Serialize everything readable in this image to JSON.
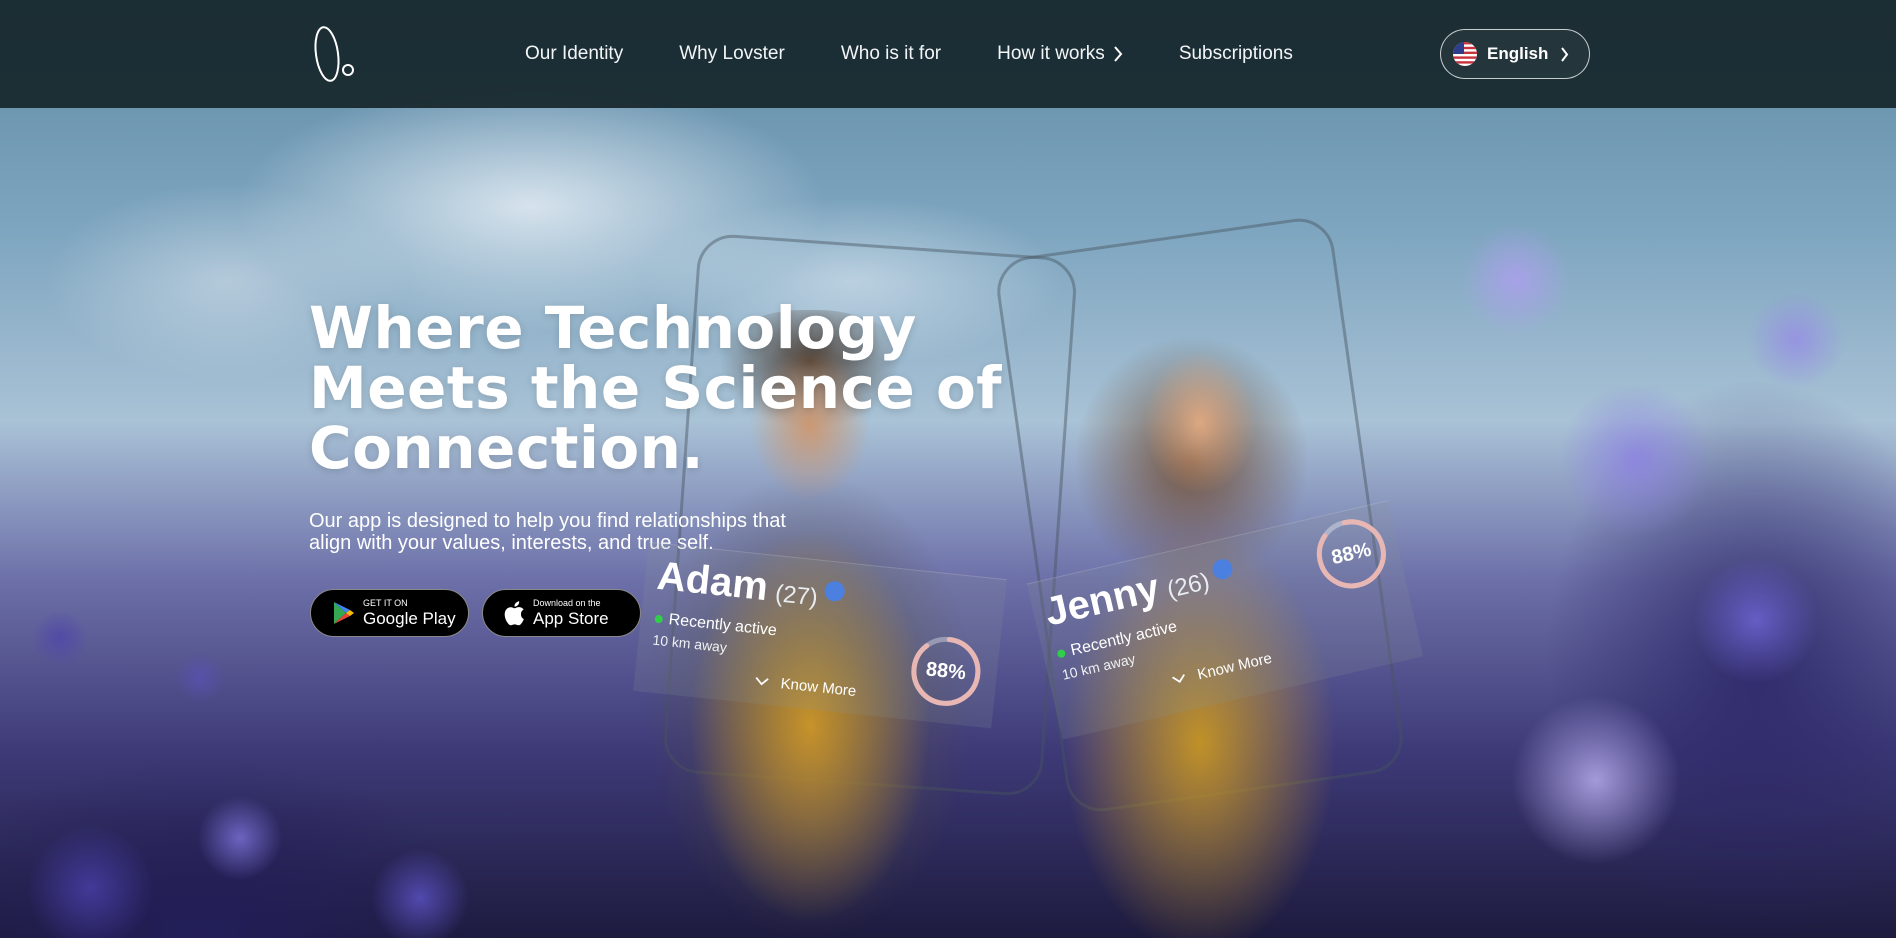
{
  "nav": {
    "logo_icon": "lovster-logo",
    "links": [
      {
        "label": "Our Identity"
      },
      {
        "label": "Why Lovster"
      },
      {
        "label": "Who is it for"
      },
      {
        "label": "How it works",
        "has_chevron": true
      },
      {
        "label": "Subscriptions"
      }
    ],
    "language": {
      "label": "English",
      "flag_icon": "us-flag-icon"
    }
  },
  "hero": {
    "title": "Where Technology Meets the Science of Connection.",
    "subtitle": "Our app is designed to help you find relationships that align with your values, interests, and true self.",
    "google_play": {
      "small": "GET IT ON",
      "big": "Google Play"
    },
    "app_store": {
      "small": "Download on the",
      "big": "App Store"
    }
  },
  "profiles": [
    {
      "name": "Adam",
      "age": "(27)",
      "status": "Recently active",
      "distance": "10 km away",
      "match": "88%",
      "match_value": 0.88,
      "more": "Know More"
    },
    {
      "name": "Jenny",
      "age": "(26)",
      "status": "Recently active",
      "distance": "10 km away",
      "match": "88%",
      "match_value": 0.88,
      "more": "Know More"
    }
  ],
  "colors": {
    "nav_bg": "#16262a",
    "status_dot": "#2fcf4a",
    "verified": "#4b7fe0",
    "ring": "#e8b7b4"
  }
}
